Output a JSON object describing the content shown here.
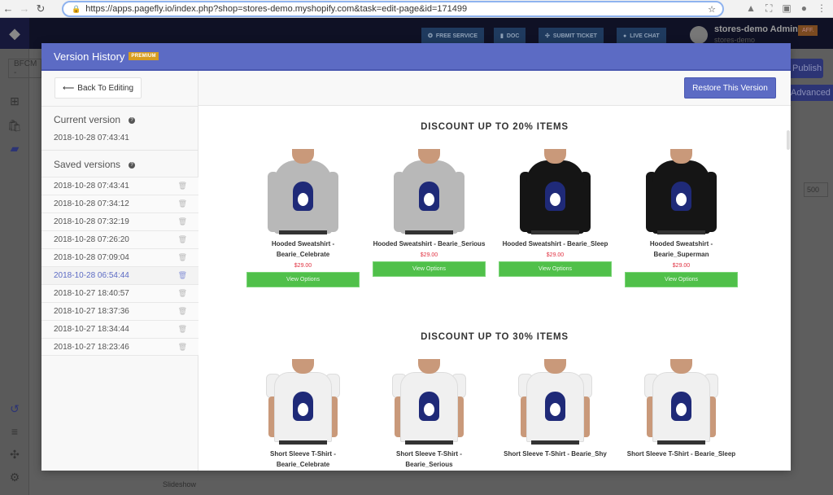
{
  "browser": {
    "url": "https://apps.pagefly.io/index.php?shop=stores-demo.myshopify.com&task=edit-page&id=171499"
  },
  "appbar": {
    "buttons": [
      "FREE SERVICE",
      "DOC",
      "SUBMIT TICKET",
      "LIVE CHAT"
    ],
    "user_name": "stores-demo Admin",
    "user_sub": "stores-demo",
    "badge": "AFF."
  },
  "background": {
    "page_select": "BFCM -",
    "publish": "Publish",
    "advanced": "Advanced",
    "slideshow": "Slideshow",
    "number_field": "500"
  },
  "modal": {
    "title": "Version History",
    "badge": "PREMIUM",
    "back_label": "Back To Editing",
    "restore_label": "Restore This Version",
    "current_heading": "Current version",
    "current_value": "2018-10-28 07:43:41",
    "saved_heading": "Saved versions",
    "versions": [
      "2018-10-28 07:43:41",
      "2018-10-28 07:34:12",
      "2018-10-28 07:32:19",
      "2018-10-28 07:26:20",
      "2018-10-28 07:09:04",
      "2018-10-28 06:54:44",
      "2018-10-27 18:40:57",
      "2018-10-27 18:37:36",
      "2018-10-27 18:34:44",
      "2018-10-27 18:23:46"
    ],
    "active_version": "2018-10-28 06:54:44"
  },
  "preview": {
    "sections": [
      {
        "title": "DISCOUNT UP TO 20% ITEMS",
        "products": [
          {
            "name": "Hooded Sweatshirt - Bearie_Celebrate",
            "price": "$29.00",
            "button": "View Options",
            "type": "hoodie",
            "color": "#b8b8b8"
          },
          {
            "name": "Hooded Sweatshirt - Bearie_Serious",
            "price": "$29.00",
            "button": "View Options",
            "type": "hoodie",
            "color": "#b8b8b8"
          },
          {
            "name": "Hooded Sweatshirt - Bearie_Sleep",
            "price": "$29.00",
            "button": "View Options",
            "type": "hoodie",
            "color": "#151515"
          },
          {
            "name": "Hooded Sweatshirt - Bearie_Superman",
            "price": "$29.00",
            "button": "View Options",
            "type": "hoodie",
            "color": "#151515"
          }
        ]
      },
      {
        "title": "DISCOUNT UP TO 30% ITEMS",
        "products": [
          {
            "name": "Short Sleeve T-Shirt - Bearie_Celebrate",
            "type": "tee",
            "color": "#f0f0f0"
          },
          {
            "name": "Short Sleeve T-Shirt - Bearie_Serious",
            "type": "tee",
            "color": "#f0f0f0"
          },
          {
            "name": "Short Sleeve T-Shirt - Bearie_Shy",
            "type": "tee",
            "color": "#f0f0f0"
          },
          {
            "name": "Short Sleeve T-Shirt - Bearie_Sleep",
            "type": "tee",
            "color": "#f0f0f0"
          }
        ]
      }
    ]
  },
  "colors": {
    "accent": "#5c6bc4",
    "premium": "#d79d20",
    "button_green": "#50c04a",
    "price": "#e03040"
  }
}
